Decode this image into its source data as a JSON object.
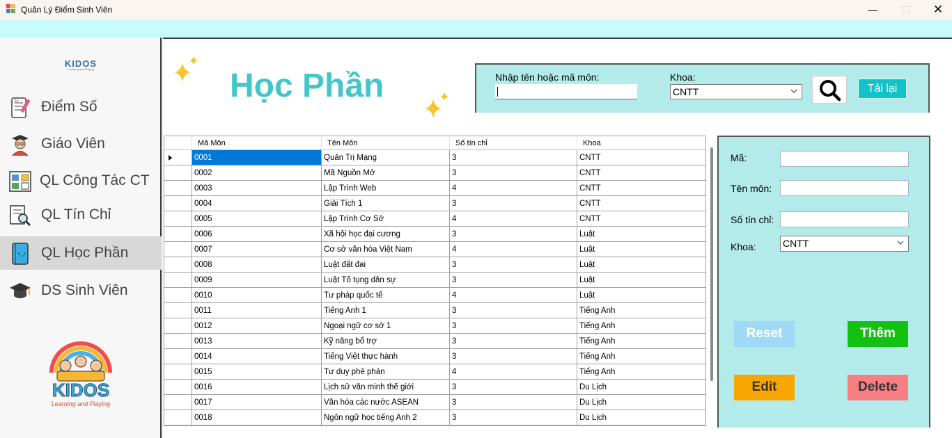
{
  "window": {
    "title": "Quản Lý Điểm Sinh Viên"
  },
  "sidebar": {
    "logo_small": {
      "brand": "KIDOS",
      "tagline": "Learning and Playing"
    },
    "items": [
      {
        "label": "Điểm Số",
        "icon": "grade-sheet-icon"
      },
      {
        "label": "Giáo Viên",
        "icon": "teacher-icon"
      },
      {
        "label": "QL Công Tác CT",
        "icon": "work-board-icon"
      },
      {
        "label": "QL Tín Chỉ",
        "icon": "document-search-icon"
      },
      {
        "label": "QL Học Phần",
        "icon": "notebook-icon",
        "active": true
      },
      {
        "label": "DS Sinh Viên",
        "icon": "graduation-cap-icon"
      }
    ],
    "logo_big": {
      "brand": "KIDOS",
      "tagline": "Learning and Playing"
    }
  },
  "main": {
    "title": "Học Phần",
    "search": {
      "label": "Nhập tên hoặc mã môn:",
      "value": "",
      "khoa_label": "Khoa:",
      "khoa_value": "CNTT",
      "reload_label": "Tải lại"
    },
    "grid": {
      "columns": [
        "Mã Môn",
        "Tên Môn",
        "Số tín chỉ",
        "Khoa"
      ],
      "rows": [
        [
          "0001",
          "Quản Trị Mạng",
          "3",
          "CNTT"
        ],
        [
          "0002",
          "Mã Nguồn Mở",
          "3",
          "CNTT"
        ],
        [
          "0003",
          "Lập Trình Web",
          "4",
          "CNTT"
        ],
        [
          "0004",
          "Giải Tích 1",
          "3",
          "CNTT"
        ],
        [
          "0005",
          "Lập Trình Cơ Sở",
          "4",
          "CNTT"
        ],
        [
          "0006",
          "Xã hội học đại cương",
          "3",
          "Luật"
        ],
        [
          "0007",
          "Cơ sở văn hóa Việt Nam",
          "4",
          "Luật"
        ],
        [
          "0008",
          "Luật đất đai",
          "3",
          "Luật"
        ],
        [
          "0009",
          "Luật Tố tụng dân sự",
          "3",
          "Luật"
        ],
        [
          "0010",
          "Tư pháp quốc tế",
          "4",
          "Luật"
        ],
        [
          "0011",
          "Tiếng Anh 1",
          "3",
          "Tiếng Anh"
        ],
        [
          "0012",
          "Ngoại ngữ cơ sở 1",
          "3",
          "Tiếng Anh"
        ],
        [
          "0013",
          "Kỹ năng bổ trợ",
          "3",
          "Tiếng Anh"
        ],
        [
          "0014",
          "Tiếng Việt thực hành",
          "3",
          "Tiếng Anh"
        ],
        [
          "0015",
          "Tư duy phê phán",
          "4",
          "Tiếng Anh"
        ],
        [
          "0016",
          " Lịch sử văn minh thế giới",
          "3",
          "Du Lịch"
        ],
        [
          "0017",
          "Văn hóa các nước ASEAN",
          "3",
          "Du Lịch"
        ],
        [
          "0018",
          "Ngôn ngữ học tiếng Anh 2",
          "3",
          "Du Lịch"
        ]
      ]
    },
    "form": {
      "ma_label": "Mã:",
      "ten_label": "Tên môn:",
      "tinchi_label": "Số tín chỉ:",
      "khoa_label": "Khoa:",
      "khoa_value": "CNTT",
      "reset_label": "Reset",
      "them_label": "Thêm",
      "edit_label": "Edit",
      "delete_label": "Delete"
    }
  },
  "colors": {
    "accent": "#44c6c9",
    "panel": "#b3ebeb",
    "reset": "#9fd9f7",
    "them": "#12c112",
    "edit": "#f7a600",
    "delete": "#f77f82",
    "selection": "#0078d7"
  }
}
